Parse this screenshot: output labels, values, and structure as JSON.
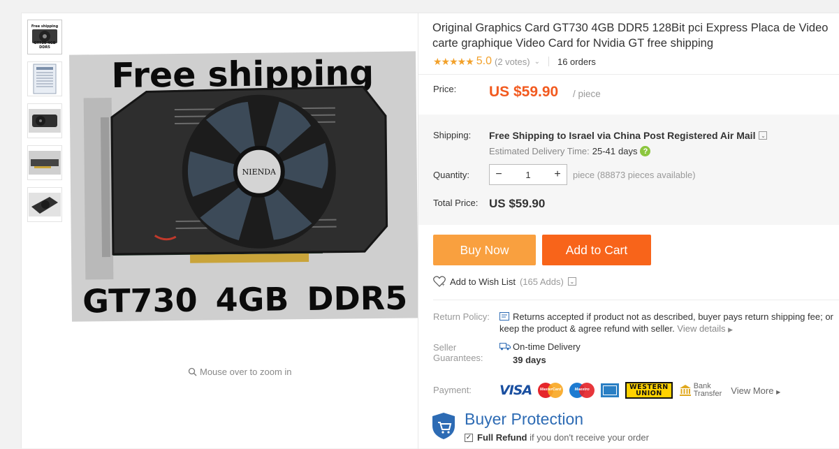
{
  "gallery": {
    "thumbnails": [
      {
        "caption_top": "Free shipping",
        "caption_bottom": "GT730 4GB DDR5"
      },
      {
        "caption_top": "",
        "caption_bottom": ""
      },
      {
        "caption_top": "",
        "caption_bottom": ""
      },
      {
        "caption_top": "",
        "caption_bottom": ""
      },
      {
        "caption_top": "",
        "caption_bottom": ""
      }
    ],
    "main_image": {
      "header_text": "Free shipping",
      "footer_text": "GT730  4GB  DDR5",
      "fan_brand": "NIENDA"
    },
    "zoom_hint": "Mouse over to zoom in"
  },
  "product": {
    "title": "Original Graphics Card GT730 4GB DDR5 128Bit pci Express Placa de Video carte graphique Video Card for Nvidia GT free shipping",
    "rating": {
      "stars": "★★★★★",
      "score": "5.0",
      "votes": "(2 votes)",
      "orders": "16 orders"
    },
    "price_label": "Price:",
    "price": "US $59.90",
    "per": "/ piece"
  },
  "shipping": {
    "label": "Shipping:",
    "method": "Free Shipping to Israel via China Post Registered Air Mail",
    "eta_label": "Estimated Delivery Time:",
    "eta_days": "25-41",
    "eta_unit": "days"
  },
  "quantity": {
    "label": "Quantity:",
    "minus": "−",
    "value": "1",
    "plus": "+",
    "available": "piece (88873 pieces available)"
  },
  "total": {
    "label": "Total Price:",
    "value": "US $59.90"
  },
  "actions": {
    "buy_now": "Buy Now",
    "add_to_cart": "Add to Cart",
    "wishlist": "Add to Wish List",
    "wishlist_count": "(165 Adds)"
  },
  "guarantees": {
    "return_label": "Return Policy:",
    "return_text": "Returns accepted if product not as described, buyer pays return shipping fee; or keep the product & agree refund with seller.",
    "view_details": "View details",
    "seller_label_1": "Seller",
    "seller_label_2": "Guarantees:",
    "ontime": "On-time Delivery",
    "ontime_days": "39 days"
  },
  "payment": {
    "label": "Payment:",
    "visa": "VISA",
    "mastercard": "MasterCard",
    "maestro": "Maestro",
    "wu_line1": "WESTERN",
    "wu_line2": "UNION",
    "bank_1": "Bank",
    "bank_2": "Transfer",
    "view_more": "View More"
  },
  "protection": {
    "title": "Buyer Protection",
    "full_refund": "Full Refund",
    "refund_text": "if you don't receive your order"
  },
  "colors": {
    "accent": "#f25a1f",
    "buy_now": "#f9a03f",
    "add_to_cart": "#f8641a",
    "star": "#f2a12b",
    "protection_blue": "#2d6bb4"
  }
}
